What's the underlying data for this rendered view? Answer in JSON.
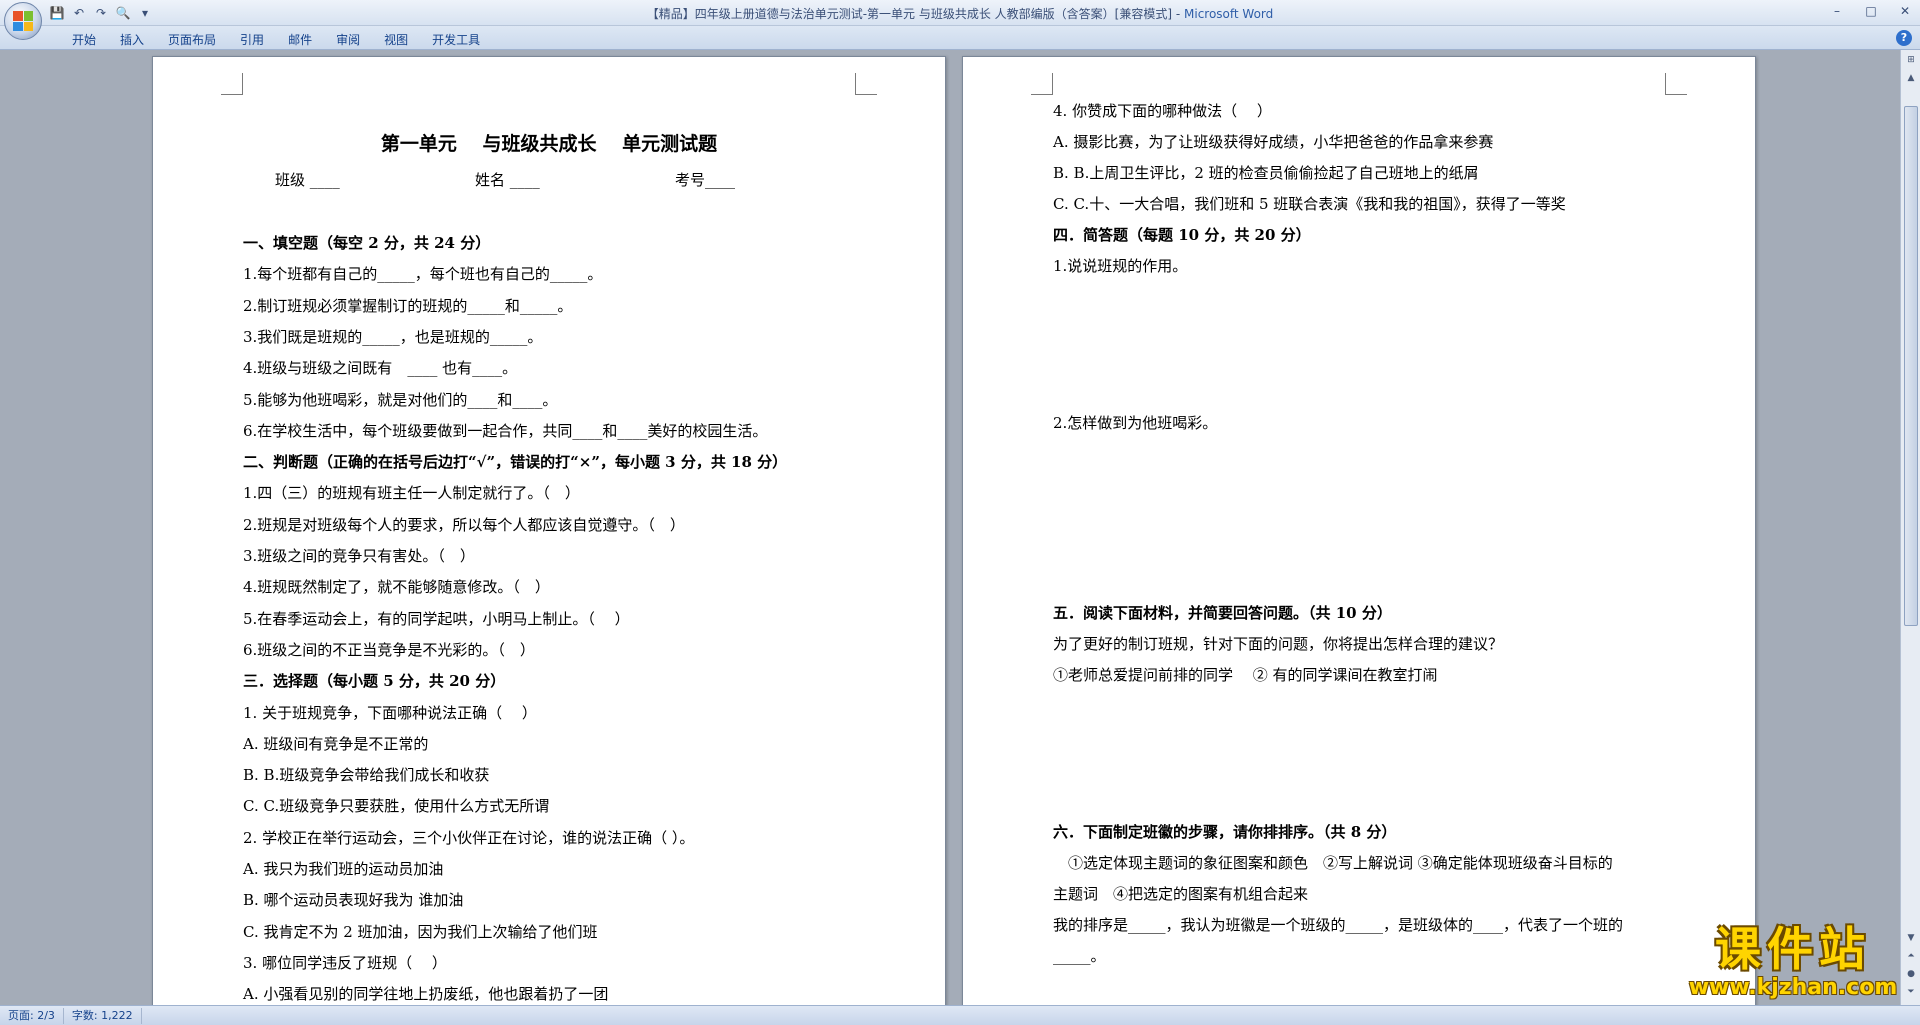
{
  "window": {
    "title": "【精品】四年级上册道德与法治单元测试-第一单元 与班级共成长 人教部编版（含答案）[兼容模式] - ",
    "app_name": "Microsoft Word"
  },
  "qat": {
    "icons": [
      "save-icon",
      "undo-icon",
      "redo-icon",
      "print-preview-icon",
      "customize-icon"
    ],
    "glyphs": [
      "💾",
      "↶",
      "↷",
      "🔍",
      "▾"
    ]
  },
  "ribbon": {
    "tabs": [
      "开始",
      "插入",
      "页面布局",
      "引用",
      "邮件",
      "审阅",
      "视图",
      "开发工具"
    ],
    "help": "?"
  },
  "win_controls": {
    "minimize": "–",
    "maximize": "□",
    "close": "✕"
  },
  "page_left": {
    "title": "第一单元　 与班级共成长　 单元测试题",
    "fields": {
      "class": "班级 ____",
      "name": "姓名 ____",
      "exam_no": "考号____"
    },
    "lines": [
      {
        "text": "一、填空题（每空 2 分，共 24 分）",
        "bold": true
      },
      {
        "text": "1.每个班都有自己的_____，每个班也有自己的_____。",
        "bold": false
      },
      {
        "text": "2.制订班规必须掌握制订的班规的_____和_____。",
        "bold": false
      },
      {
        "text": "3.我们既是班规的_____，也是班规的_____。",
        "bold": false
      },
      {
        "text": "4.班级与班级之间既有　____ 也有____。",
        "bold": false
      },
      {
        "text": "5.能够为他班喝彩，就是对他们的____和____。",
        "bold": false
      },
      {
        "text": "6.在学校生活中，每个班级要做到一起合作，共同____和____美好的校园生活。",
        "bold": false
      },
      {
        "text": "二、判断题（正确的在括号后边打“√”，错误的打“×”，每小题 3 分，共 18 分）",
        "bold": true
      },
      {
        "text": "1.四（三）的班规有班主任一人制定就行了。（　）",
        "bold": false
      },
      {
        "text": "2.班规是对班级每个人的要求，所以每个人都应该自觉遵守。（　）",
        "bold": false
      },
      {
        "text": "3.班级之间的竞争只有害处。（　）",
        "bold": false
      },
      {
        "text": "4.班规既然制定了，就不能够随意修改。（　）",
        "bold": false
      },
      {
        "text": "5.在春季运动会上，有的同学起哄，小明马上制止。（　 ）",
        "bold": false
      },
      {
        "text": "6.班级之间的不正当竞争是不光彩的。（　）",
        "bold": false
      },
      {
        "text": "三．选择题（每小题 5 分，共 20 分）",
        "bold": true
      },
      {
        "text": "1. 关于班规竞争，下面哪种说法正确（　 ）",
        "bold": false
      },
      {
        "text": "A. 班级间有竞争是不正常的",
        "bold": false
      },
      {
        "text": "B. B.班级竞争会带给我们成长和收获",
        "bold": false
      },
      {
        "text": "C. C.班级竞争只要获胜，使用什么方式无所谓",
        "bold": false
      },
      {
        "text": "2. 学校正在举行运动会，三个小伙伴正在讨论，谁的说法正确（ ）。",
        "bold": false
      },
      {
        "text": "A. 我只为我们班的运动员加油",
        "bold": false
      },
      {
        "text": "B. 哪个运动员表现好我为 谁加油",
        "bold": false
      },
      {
        "text": "C. 我肯定不为 2 班加油，因为我们上次输给了他们班",
        "bold": false
      },
      {
        "text": "3. 哪位同学违反了班规（　 ）",
        "bold": false
      },
      {
        "text": "A. 小强看见别的同学往地上扔废纸，他也跟着扔了一团",
        "bold": false
      }
    ]
  },
  "page_right": {
    "lines": [
      {
        "text": "4. 你赞成下面的哪种做法（　 ）",
        "bold": false
      },
      {
        "text": "A. 摄影比赛，为了让班级获得好成绩，小华把爸爸的作品拿来参赛",
        "bold": false
      },
      {
        "text": "B. B.上周卫生评比，2 班的检查员偷偷捡起了自己班地上的纸屑",
        "bold": false
      },
      {
        "text": "C. C.十、一大合唱，我们班和 5 班联合表演《我和我的祖国》，获得了一等奖",
        "bold": false
      },
      {
        "text": "四．简答题（每题 10 分，共 20 分）",
        "bold": true
      },
      {
        "text": "1.说说班规的作用。",
        "bold": false
      },
      {
        "text": "2.怎样做到为他班喝彩。",
        "bold": false
      },
      {
        "text": "五．阅读下面材料，并简要回答问题。（共 10 分）",
        "bold": true
      },
      {
        "text": "为了更好的制订班规，针对下面的问题，你将提出怎样合理的建议？",
        "bold": false
      },
      {
        "text": "①老师总爱提问前排的同学　 ② 有的同学课间在教室打闹",
        "bold": false
      },
      {
        "text": "六．下面制定班徽的步骤，请你排排序。（共 8 分）",
        "bold": true
      },
      {
        "text": "　①选定体现主题词的象征图案和颜色　②写上解说词 ③确定能体现班级奋斗目标的",
        "bold": false
      },
      {
        "text": "主题词　④把选定的图案有机组合起来",
        "bold": false
      },
      {
        "text": "我的排序是_____，我认为班徽是一个班级的_____，是班级体的____，代表了一个班的",
        "bold": false
      },
      {
        "text": "_____。",
        "bold": false
      }
    ]
  },
  "status": {
    "page": "页面: 2/3",
    "words": "字数: 1,222"
  },
  "watermark": {
    "name": "课件站",
    "url": "www.kjzhan.com"
  }
}
